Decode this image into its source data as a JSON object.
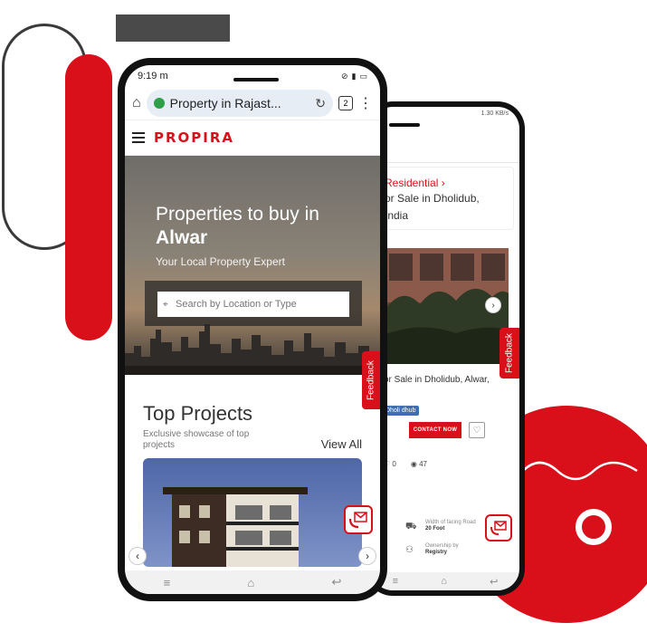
{
  "colors": {
    "brand_red": "#d9101a",
    "text_dark": "#333333",
    "tag_blue": "#3f6fb0"
  },
  "front_phone": {
    "status": {
      "time": "9:19",
      "carrier_icon": "m"
    },
    "browser": {
      "url_text": "Property in Rajast...",
      "tab_count": "2",
      "icons": [
        "home-icon",
        "secure-shield-icon",
        "reload-icon",
        "tabs-icon",
        "more-vert-icon"
      ]
    },
    "site": {
      "logo": "PROPIRA"
    },
    "hero": {
      "title_line1": "Properties to buy in",
      "title_line2": "Alwar",
      "subtitle": "Your Local Property Expert",
      "search_placeholder": "Search by Location or Type"
    },
    "feedback_label": "Feedback",
    "top_projects": {
      "title": "Top Projects",
      "subtitle": "Exclusive showcase of top projects",
      "view_all": "View All"
    }
  },
  "back_phone": {
    "status_text": "1.30 KB/s",
    "listing": {
      "category": "Residential",
      "title_line1": "or Sale in Dholidub,",
      "title_line2": "India",
      "address": "or Sale in Dholidub, Alwar,",
      "tag": "Dholi dhub",
      "contact_label": "CONTACT NOW",
      "likes": "0",
      "views": "47"
    },
    "specs": [
      {
        "label": "Width of facing Road",
        "value": "20 Foot",
        "icon": "road-icon"
      },
      {
        "label": "Ownership by",
        "value": "Registry",
        "icon": "owner-icon"
      }
    ],
    "feedback_label": "Feedback"
  }
}
